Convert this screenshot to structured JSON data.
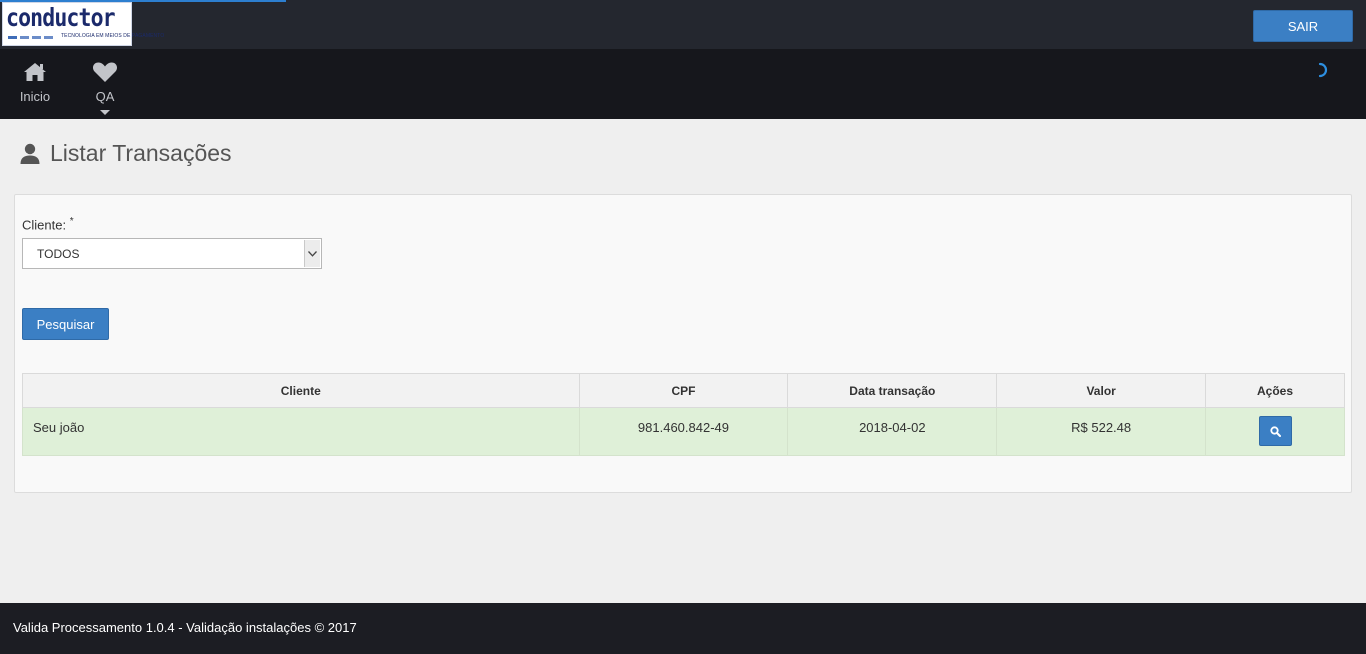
{
  "brand": {
    "logo_word": "conductor",
    "logo_tagline": "TECNOLOGIA EM MEIOS DE PAGAMENTO"
  },
  "header": {
    "logout_label": "SAIR"
  },
  "nav": {
    "items": [
      {
        "label": "Inicio",
        "icon": "home-icon"
      },
      {
        "label": "QA",
        "icon": "heart-icon"
      }
    ]
  },
  "page": {
    "title": "Listar Transações",
    "title_icon": "user-icon"
  },
  "form": {
    "client_label": "Cliente:",
    "required_mark": "*",
    "client_selected": "TODOS",
    "search_label": "Pesquisar"
  },
  "table": {
    "columns": [
      "Cliente",
      "CPF",
      "Data transação",
      "Valor",
      "Ações"
    ],
    "rows": [
      {
        "cliente": "Seu joão",
        "cpf": "981.460.842-49",
        "data": "2018-04-02",
        "valor": "R$ 522.48"
      }
    ]
  },
  "footer": {
    "text": "Valida Processamento 1.0.4 - Validação instalações © 2017"
  },
  "colors": {
    "primary": "#3b7fc4",
    "topbar": "#24272f",
    "navbar": "#16171c",
    "row_success": "#dff0d8",
    "footer": "#1c1d23"
  }
}
